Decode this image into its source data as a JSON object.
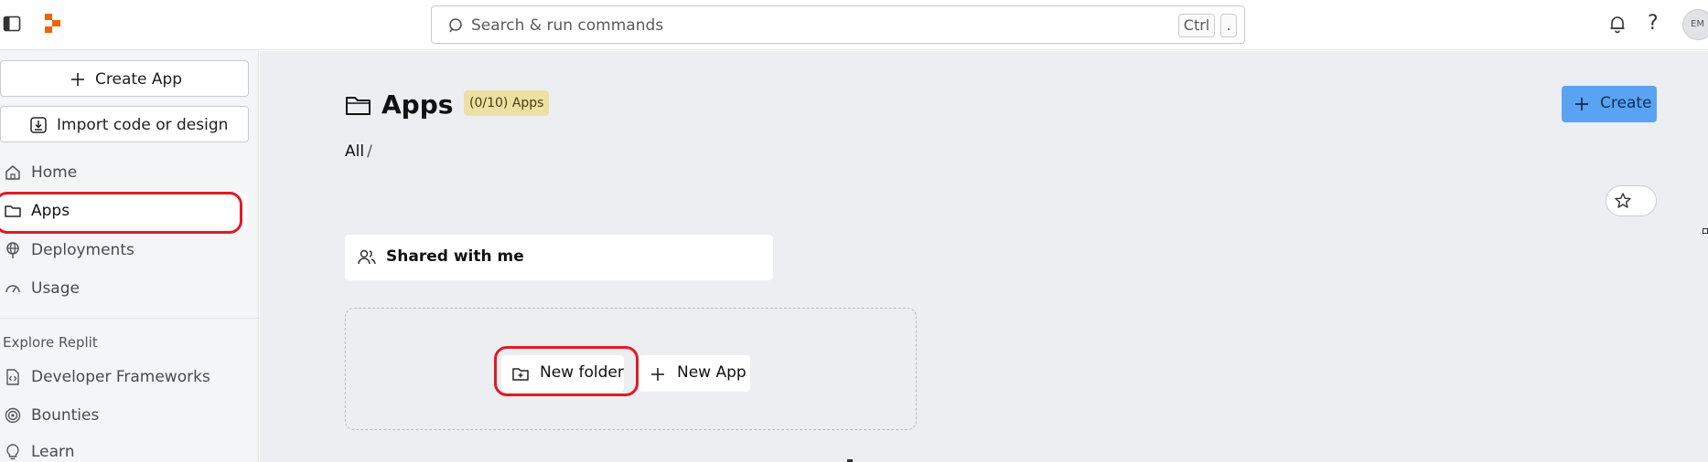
{
  "topbar": {
    "search_placeholder": "Search & run commands",
    "kbd_ctrl": "Ctrl",
    "kbd_dot": ".",
    "help_label": "?",
    "avatar_initials": "EM",
    "logo_color": "#f26207"
  },
  "sidebar": {
    "create_app_label": "Create App",
    "import_label": "Import code or design",
    "items": [
      {
        "label": "Home",
        "icon": "home-icon"
      },
      {
        "label": "Apps",
        "icon": "folder-icon",
        "active": true
      },
      {
        "label": "Deployments",
        "icon": "deployments-icon"
      },
      {
        "label": "Usage",
        "icon": "gauge-icon"
      }
    ],
    "explore_title": "Explore Replit",
    "explore_items": [
      {
        "label": "Developer Frameworks",
        "icon": "code-file-icon"
      },
      {
        "label": "Bounties",
        "icon": "target-icon"
      },
      {
        "label": "Learn",
        "icon": "lightbulb-icon"
      }
    ]
  },
  "main": {
    "title": "Apps",
    "badge": "(0/10) Apps",
    "create_label": "Create",
    "breadcrumb_root": "All",
    "breadcrumb_sep": "/",
    "shared_label": "Shared with me",
    "new_folder_label": "New folder",
    "new_app_label": "New App"
  },
  "colors": {
    "accent": "#5aa3f3",
    "badge_bg": "#ece0a3",
    "annotation": "#e01b24"
  }
}
